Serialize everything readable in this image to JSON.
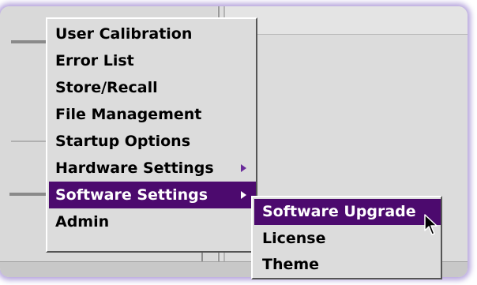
{
  "menu": {
    "items": [
      {
        "label": "User Calibration"
      },
      {
        "label": "Error List"
      },
      {
        "label": "Store/Recall"
      },
      {
        "label": "File Management"
      },
      {
        "label": "Startup Options"
      },
      {
        "label": "Hardware Settings",
        "submenu_icon": "chevron-right-icon"
      },
      {
        "label": "Software Settings",
        "submenu_icon": "chevron-right-icon",
        "selected": true
      },
      {
        "label": "Admin"
      }
    ]
  },
  "submenu": {
    "items": [
      {
        "label": "Software Upgrade",
        "selected": true
      },
      {
        "label": "License"
      },
      {
        "label": "Theme"
      }
    ]
  },
  "colors": {
    "selection": "#4c0a6e",
    "menu_background": "#dcdcdc",
    "submenu_arrow": "#6a2b9a",
    "window_glow": "#aa96d7"
  },
  "cursor": {
    "icon": "mouse-pointer-icon"
  }
}
